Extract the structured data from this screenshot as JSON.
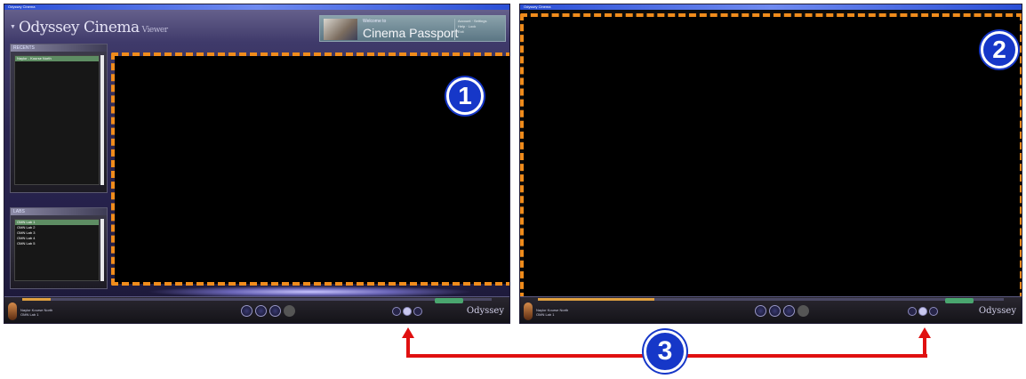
{
  "window1": {
    "titlebar": "Odyssey Cinema",
    "logo_text": "Odyssey Cinema",
    "logo_suffix": "Viewer",
    "passport": {
      "welcome": "Welcome to",
      "title": "Cinema Passport",
      "links": [
        "Account · Settings",
        "Help · Lock",
        "Exit"
      ]
    },
    "recents": {
      "header": "RECENTS",
      "items": [
        "Naylor - Kourse North"
      ]
    },
    "labs": {
      "header": "LABS",
      "items": [
        "OMN Lab 1",
        "OMN Lab 2",
        "OMN Lab 3",
        "OMN Lab 4",
        "OMN Lab 5"
      ]
    },
    "bottombar": {
      "now_playing": [
        "Naylor Kourse North",
        "OMN Lab 1"
      ],
      "status_button": "",
      "brand": "Odyssey"
    }
  },
  "window2": {
    "titlebar": "Odyssey Cinema",
    "bottombar": {
      "now_playing": [
        "Naylor Kourse North",
        "OMN Lab 1"
      ],
      "status_button": "",
      "brand": "Odyssey"
    }
  },
  "callouts": [
    "1",
    "2",
    "3"
  ],
  "colors": {
    "highlight_dash": "#f08c1c",
    "badge_blue": "#1637c8",
    "arrow_red": "#e01010"
  }
}
